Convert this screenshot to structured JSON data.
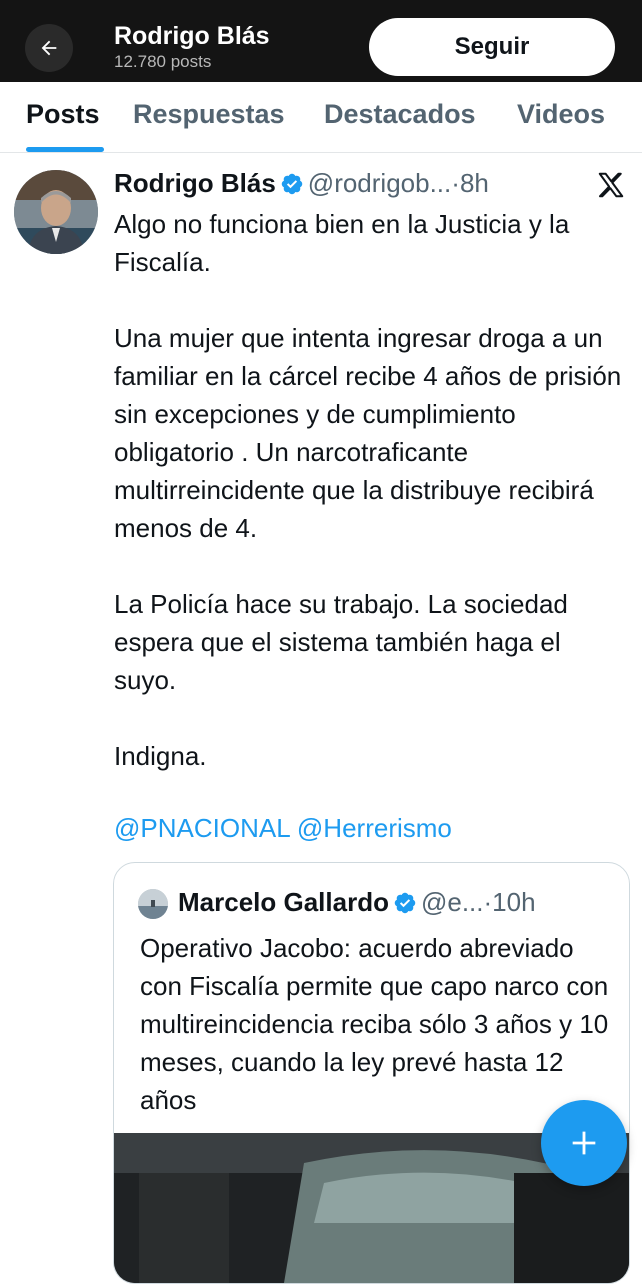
{
  "header": {
    "title": "Rodrigo Blás",
    "post_count": "12.780 posts",
    "follow_label": "Seguir"
  },
  "tabs": [
    {
      "label": "Posts",
      "active": true
    },
    {
      "label": "Respuestas",
      "active": false
    },
    {
      "label": "Destacados",
      "active": false
    },
    {
      "label": "Videos",
      "active": false
    }
  ],
  "post": {
    "author_name": "Rodrigo Blás",
    "handle": "@rodrigob...",
    "separator": "·",
    "time": "8h",
    "text": "Algo no funciona bien en la Justicia y la Fiscalía.\n\nUna mujer que intenta ingresar droga a un familiar en la cárcel recibe 4 años de prisión sin excepciones y de cumplimiento obligatorio . Un narcotraficante multirreincidente que la distribuye recibirá menos de 4.\n\nLa Policía hace su trabajo. La sociedad espera que el sistema también haga el suyo.\n\nIndigna.",
    "mentions": "@PNACIONAL @Herrerismo",
    "quote": {
      "author_name": "Marcelo Gallardo",
      "handle": "@e...",
      "separator": "·",
      "time": "10h",
      "text": "Operativo Jacobo: acuerdo abreviado con Fiscalía permite que capo narco con multireincidencia reciba sólo 3 años y 10 meses, cuando la ley prevé hasta 12 años"
    }
  },
  "icons": {
    "back": "arrow-left-icon",
    "verified": "verified-badge-icon",
    "grok": "slash-x-icon",
    "compose": "plus-icon"
  },
  "colors": {
    "accent": "#1d9bf0",
    "header_bg": "#141414",
    "text_secondary": "#536471"
  }
}
